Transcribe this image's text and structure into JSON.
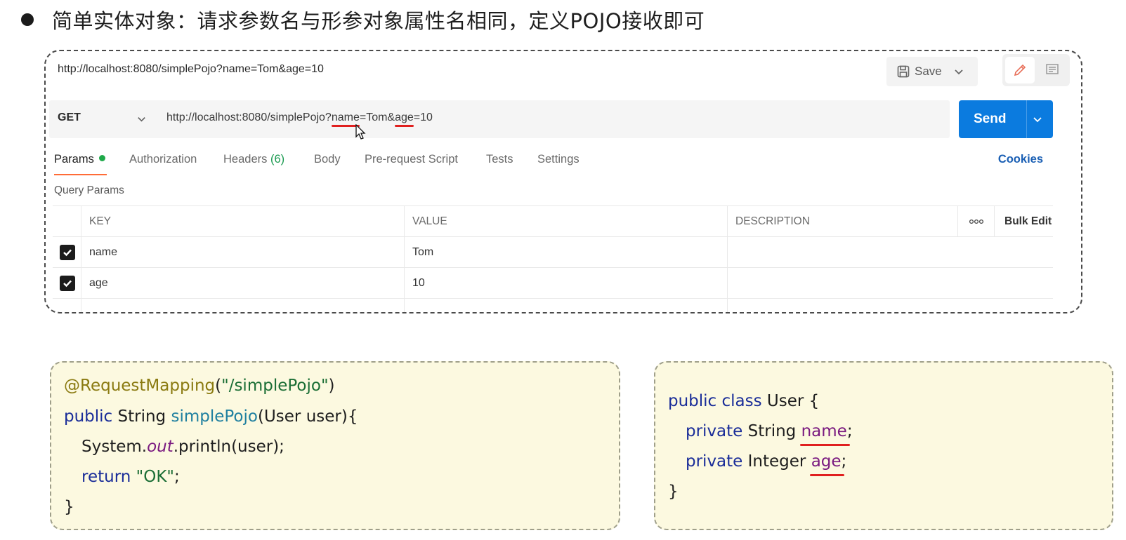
{
  "heading": {
    "text": "简单实体对象：请求参数名与形参对象属性名相同，定义POJO接收即可"
  },
  "postman": {
    "top_url": "http://localhost:8080/simplePojo?name=Tom&age=10",
    "save_label": "Save",
    "method": "GET",
    "url": {
      "prefix": "http://localhost:8080/simplePojo?",
      "param1_key": "name",
      "eq1": "=Tom&",
      "param2_key": "age",
      "eq2": "=10"
    },
    "send_label": "Send",
    "tabs": {
      "params": "Params",
      "authorization": "Authorization",
      "headers": "Headers",
      "headers_count": "(6)",
      "body": "Body",
      "pre_request": "Pre-request Script",
      "tests": "Tests",
      "settings": "Settings"
    },
    "cookies_label": "Cookies",
    "query_params_label": "Query Params",
    "table": {
      "headers": {
        "key": "KEY",
        "value": "VALUE",
        "description": "DESCRIPTION",
        "more": "ooo",
        "bulk_edit": "Bulk Edit"
      },
      "rows": [
        {
          "key": "name",
          "value": "Tom",
          "checked": true
        },
        {
          "key": "age",
          "value": "10",
          "checked": true
        }
      ]
    },
    "accent_color": "#ff6c37",
    "send_color": "#0b7bdf"
  },
  "code_left": {
    "annotation": "@RequestMapping",
    "paren_open": "(",
    "path_string": "\"/simplePojo\"",
    "paren_close": ")",
    "kw_public": "public",
    "ret_type": " String ",
    "method_name": "simplePojo",
    "params": "(User user){",
    "sys": "System.",
    "out": "out",
    "println": ".println(user);",
    "kw_return": "return",
    "ok_string": "\"OK\"",
    "semicolon": ";",
    "close_brace": "}"
  },
  "code_right": {
    "kw_public_class": "public class",
    "class_name": " User {",
    "kw_private1": "private",
    "type1": " String ",
    "field1": "name",
    "semi1": ";",
    "kw_private2": "private",
    "type2": " Integer ",
    "field2": "age",
    "semi2": ";",
    "close_brace": "}"
  }
}
